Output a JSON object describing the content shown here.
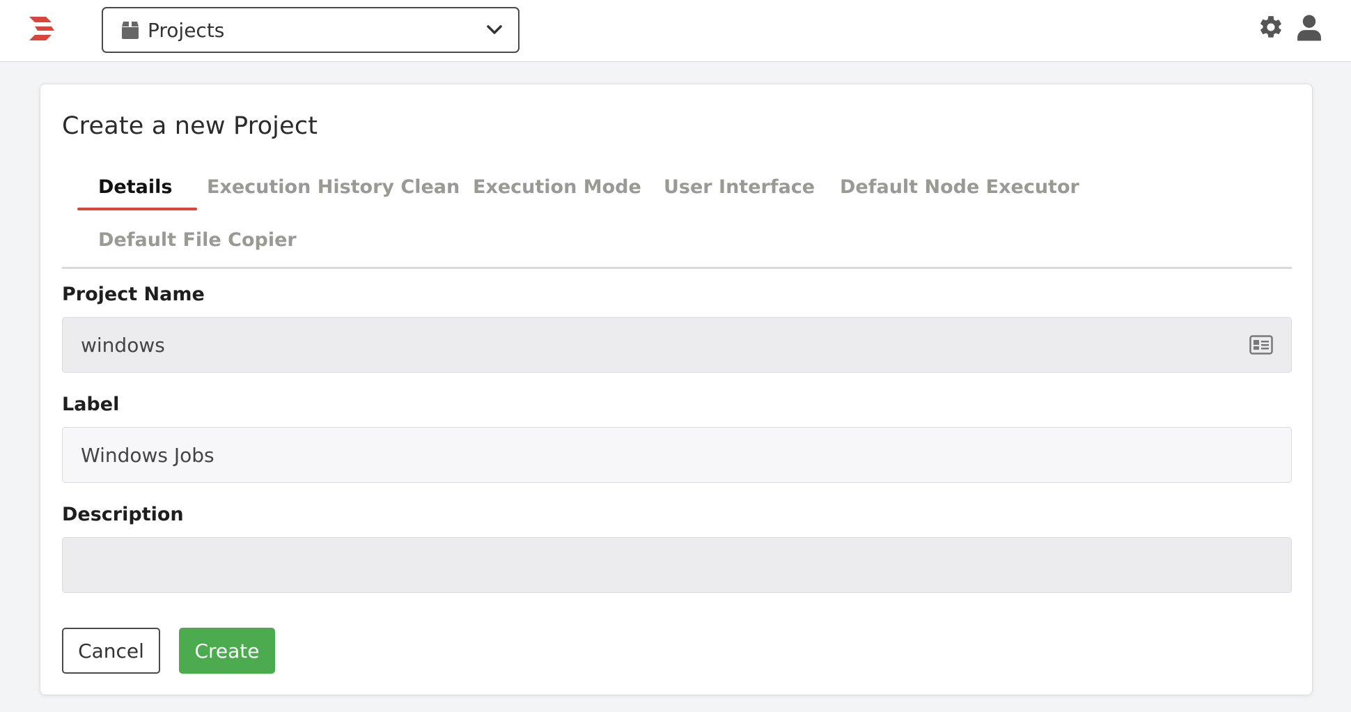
{
  "header": {
    "project_selector": {
      "label": "Projects"
    }
  },
  "colors": {
    "brand_red": "#d9453a",
    "create_green": "#4caa4f"
  },
  "form": {
    "title": "Create a new Project",
    "tabs": [
      {
        "label": "Details",
        "active": true
      },
      {
        "label": "Execution History Clean",
        "active": false
      },
      {
        "label": "Execution Mode",
        "active": false
      },
      {
        "label": "User Interface",
        "active": false
      },
      {
        "label": "Default Node Executor",
        "active": false
      },
      {
        "label": "Default File Copier",
        "active": false
      }
    ],
    "project_name": {
      "label": "Project Name",
      "value": "windows"
    },
    "label_field": {
      "label": "Label",
      "value": "Windows Jobs"
    },
    "description": {
      "label": "Description",
      "value": ""
    },
    "buttons": {
      "cancel": "Cancel",
      "create": "Create"
    }
  }
}
